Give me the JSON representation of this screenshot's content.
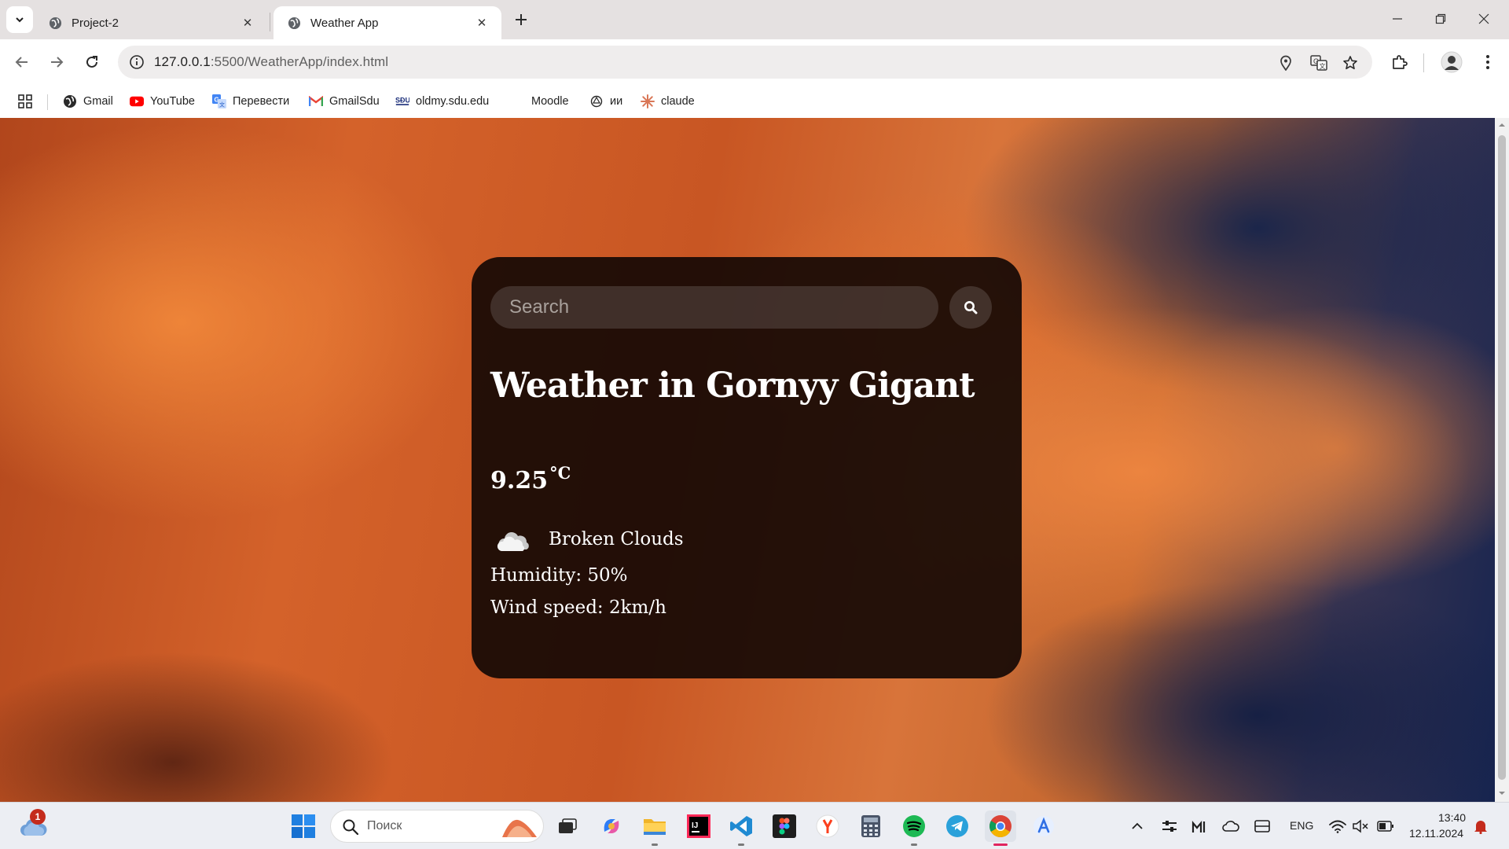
{
  "browser": {
    "tabs": [
      {
        "title": "Project-2",
        "active": false
      },
      {
        "title": "Weather App",
        "active": true
      }
    ],
    "url": {
      "host": "127.0.0.1",
      "rest": ":5500/WeatherApp/index.html"
    },
    "bookmarks": [
      {
        "label": "Gmail",
        "icon": "globe-icon"
      },
      {
        "label": "YouTube",
        "icon": "youtube-icon"
      },
      {
        "label": "Перевести",
        "icon": "translate-icon"
      },
      {
        "label": "GmailSdu",
        "icon": "gmail-icon"
      },
      {
        "label": "oldmy.sdu.edu",
        "icon": "sdu-icon"
      },
      {
        "label": "Moodle",
        "icon": ""
      },
      {
        "label": "ии",
        "icon": "openai-icon"
      },
      {
        "label": "claude",
        "icon": "claude-icon"
      }
    ]
  },
  "weather": {
    "search_placeholder": "Search",
    "title": "Weather in Gornyy Gigant",
    "temperature": "9.25",
    "unit": "°C",
    "condition": "Broken Clouds",
    "humidity": "Humidity: 50%",
    "wind": "Wind speed: 2km/h"
  },
  "taskbar": {
    "weather_badge": "1",
    "search_placeholder": "Поиск",
    "language": "ENG",
    "time": "13:40",
    "date": "12.11.2024"
  },
  "colors": {
    "card_bg": "#110704",
    "youtube_red": "#ff0000",
    "accent_blue": "#0b57d0"
  }
}
